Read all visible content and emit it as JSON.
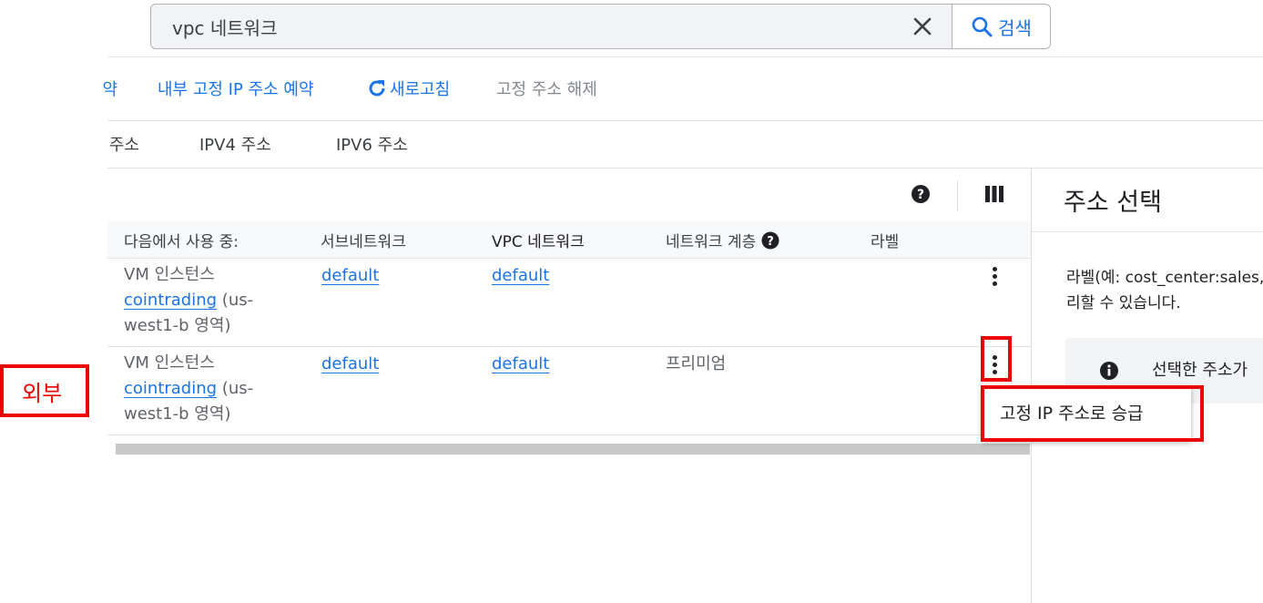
{
  "search": {
    "query": "vpc 네트워크",
    "button_label": "검색"
  },
  "toolbar": {
    "partial_label": "약",
    "reserve_internal": "내부 고정 IP 주소 예약",
    "refresh": "새로고침",
    "release": "고정 주소 해제"
  },
  "tabs": [
    "주소",
    "IPV4 주소",
    "IPV6 주소"
  ],
  "table": {
    "headers": {
      "in_use_by": "다음에서 사용 중:",
      "subnetwork": "서브네트워크",
      "vpc_network": "VPC 네트워크",
      "network_tier": "네트워크 계층",
      "labels": "라벨"
    },
    "rows": [
      {
        "in_use_prefix": "VM 인스턴스",
        "instance": "cointrading",
        "zone_a": " (us-",
        "zone_b": "west1-b 영역)",
        "subnetwork": "default",
        "vpc": "default",
        "tier": ""
      },
      {
        "in_use_prefix": "VM 인스턴스",
        "instance": "cointrading",
        "zone_a": " (us-",
        "zone_b": "west1-b 영역)",
        "subnetwork": "default",
        "vpc": "default",
        "tier": "프리미엄"
      }
    ]
  },
  "panel": {
    "title": "주소 선택",
    "text_line1": "라벨(예: cost_center:sales,",
    "text_line2": "리할 수 있습니다.",
    "info": "선택한 주소가"
  },
  "menu": {
    "promote": "고정 IP 주소로 승급"
  },
  "annotation": {
    "label": "외부"
  },
  "colors": {
    "accent": "#1a73e8",
    "highlight": "#ee0000"
  }
}
